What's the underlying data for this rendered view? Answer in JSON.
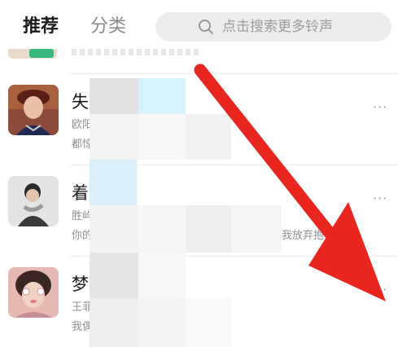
{
  "header": {
    "tabs": [
      {
        "label": "推荐",
        "active": true
      },
      {
        "label": "分类",
        "active": false
      }
    ],
    "search": {
      "placeholder": "点击搜索更多铃声",
      "icon": "search-icon"
    }
  },
  "songs": [
    {
      "title": "失",
      "artist": "欧阳",
      "desc": "都惊",
      "more": "···"
    },
    {
      "title": "着",
      "artist": "胜屿",
      "desc": "你的",
      "desc_tail": "我放弃抱",
      "more": "···"
    },
    {
      "title": "梦",
      "artist": "王菲",
      "desc": "我偶",
      "more": "···"
    }
  ],
  "annotation": {
    "type": "arrow",
    "color": "#e8261f",
    "points_to": "more-options-button"
  },
  "colors": {
    "accent": "#37b980",
    "arrow": "#e8261f",
    "search_bg": "#ececec"
  }
}
